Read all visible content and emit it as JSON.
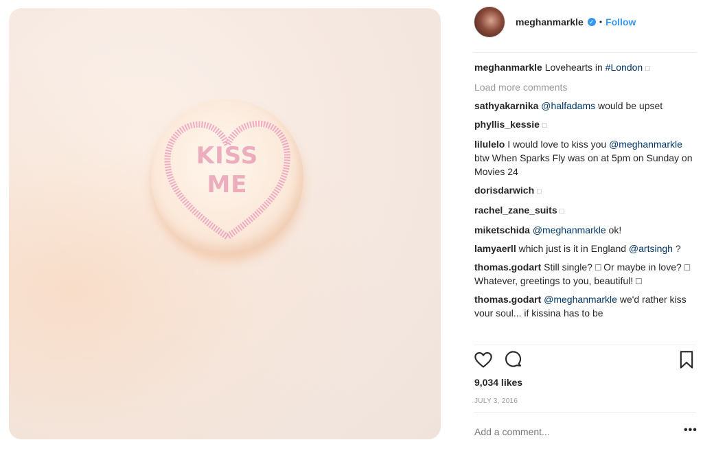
{
  "post": {
    "username": "meghanmarkle",
    "verified_icon": "verified-badge-icon",
    "separator": "•",
    "follow_label": "Follow",
    "caption_user": "meghanmarkle",
    "caption_text": "Lovehearts in",
    "caption_hashtag": "#London",
    "caption_emoji": "□",
    "load_more_label": "Load more comments",
    "candy_line1": "KISS",
    "candy_line2": "ME",
    "likes": "9,034 likes",
    "date": "JULY 3, 2016",
    "add_comment_placeholder": "Add a comment...",
    "more_label": "•••"
  },
  "comments": [
    {
      "user": "sathyakarnika",
      "mention": "@halfadams",
      "text": " would be upset"
    },
    {
      "user": "phyllis_kessie",
      "text": "□"
    },
    {
      "user": "lilulelo",
      "text": "I would love to kiss you",
      "mention": "@meghanmarkle",
      "text2": " btw When Sparks Fly was on at 5pm on Sunday on Movies 24"
    },
    {
      "user": "dorisdarwich",
      "text": "□"
    },
    {
      "user": "rachel_zane_suits",
      "text": "□"
    },
    {
      "user": "miketschida",
      "mention": "@meghanmarkle",
      "text": " ok!"
    },
    {
      "user": "lamyaerll",
      "text": "which just is it in England",
      "mention": "@artsingh",
      "text2": " ?"
    },
    {
      "user": "thomas.godart",
      "text": "Still single? □ Or maybe in love? □ Whatever, greetings to you, beautiful! □"
    },
    {
      "user": "thomas.godart",
      "mention": "@meghanmarkle",
      "text": " we'd rather kiss vour soul... if kissina has to be"
    }
  ],
  "icons": {
    "like": "heart-icon",
    "comment": "comment-bubble-icon",
    "save": "bookmark-icon"
  }
}
